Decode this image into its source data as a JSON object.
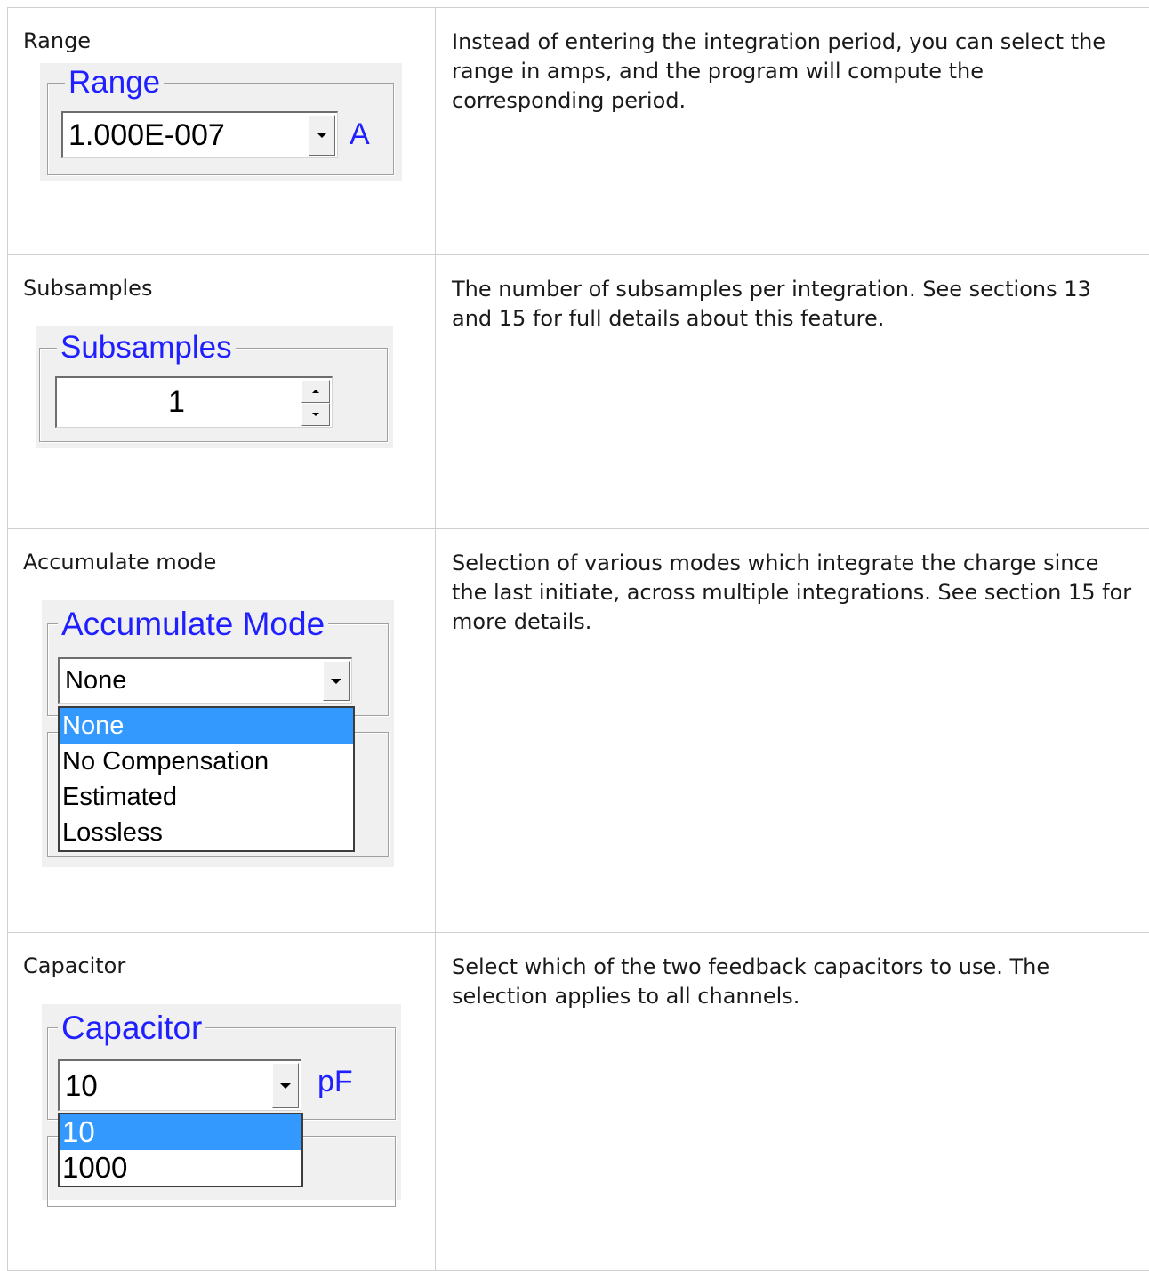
{
  "rows": [
    {
      "name": "Range",
      "description": "Instead of entering the integration period, you can select the range in amps, and the program will compute the corresponding period.",
      "widget": {
        "legend": "Range",
        "value": "1.000E-007",
        "unit": "A"
      }
    },
    {
      "name": "Subsamples",
      "description": "The number of subsamples per integration.  See sections 13 and 15 for full details about this feature.",
      "widget": {
        "legend": "Subsamples",
        "value": "1"
      }
    },
    {
      "name": "Accumulate mode",
      "description": "Selection of various modes which integrate the charge since the last initiate, across multiple integrations.  See section 15 for more details.",
      "widget": {
        "legend": "Accumulate Mode",
        "value": "None",
        "options": [
          "None",
          "No Compensation",
          "Estimated",
          "Lossless"
        ],
        "highlighted": "None"
      }
    },
    {
      "name": "Capacitor",
      "description": "Select which of the two feedback capacitors to use.  The selection applies to all channels.",
      "widget": {
        "legend": "Capacitor",
        "value": "10",
        "unit": "pF",
        "options": [
          "10",
          "1000"
        ],
        "highlighted": "10"
      }
    }
  ],
  "colors": {
    "legend_text": "#1f1fff",
    "selection_highlight": "#3399ff",
    "widget_background": "#f0f0f0"
  }
}
